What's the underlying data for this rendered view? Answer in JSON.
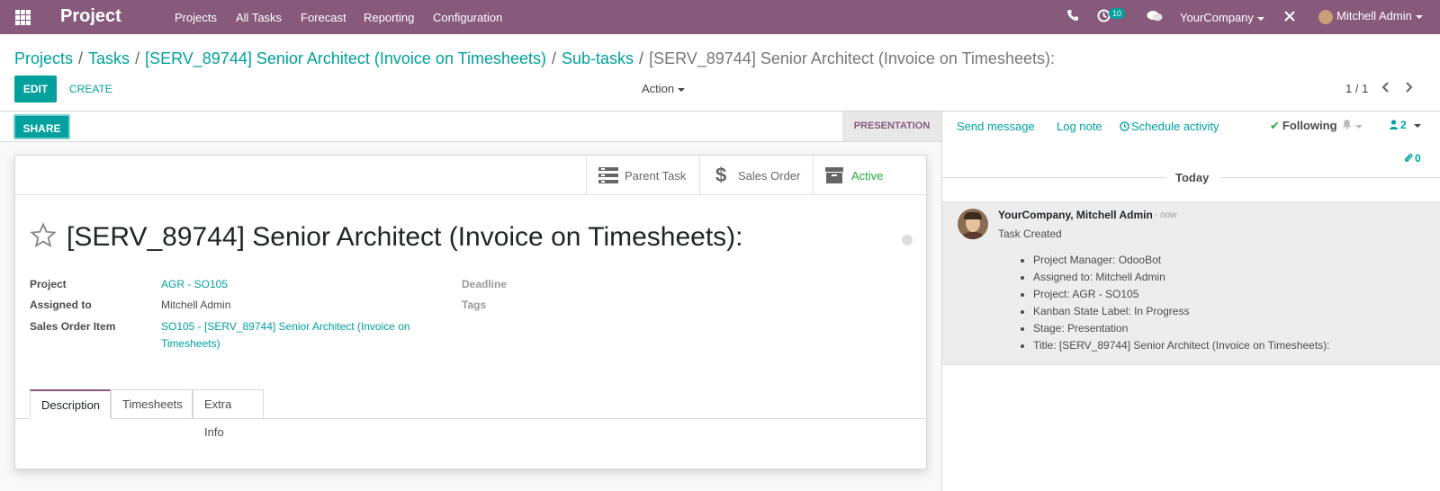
{
  "navbar": {
    "app_name": "Project",
    "menu": [
      "Projects",
      "All Tasks",
      "Forecast",
      "Reporting",
      "Configuration"
    ],
    "activity_count": "10",
    "company": "YourCompany",
    "user": "Mitchell Admin",
    "icons": [
      "apps-icon",
      "phone-icon",
      "activity-icon",
      "chat-icon",
      "debug-icon"
    ]
  },
  "breadcrumb": {
    "items": [
      "Projects",
      "Tasks",
      "[SERV_89744] Senior Architect (Invoice on Timesheets)",
      "Sub-tasks"
    ],
    "current": "[SERV_89744] Senior Architect (Invoice on Timesheets):"
  },
  "toolbar": {
    "edit_label": "EDIT",
    "create_label": "CREATE",
    "action_label": "Action",
    "pager": "1 / 1"
  },
  "statusbar": {
    "share_label": "SHARE",
    "stage": "PRESENTATION"
  },
  "smart_buttons": {
    "parent_task": "Parent Task",
    "sales_order": "Sales Order",
    "active": "Active"
  },
  "task": {
    "title": "[SERV_89744] Senior Architect (Invoice on Timesheets):",
    "fields": {
      "project_label": "Project",
      "project_value": "AGR - SO105",
      "assigned_label": "Assigned to",
      "assigned_value": "Mitchell Admin",
      "so_item_label": "Sales Order Item",
      "so_item_value_line1": "SO105 - [SERV_89744] Senior Architect (Invoice on",
      "so_item_value_line2": "Timesheets)",
      "deadline_label": "Deadline",
      "tags_label": "Tags"
    },
    "tabs": [
      "Description",
      "Timesheets",
      "Extra Info"
    ]
  },
  "chatter": {
    "send_message": "Send message",
    "log_note": "Log note",
    "schedule_activity": "Schedule activity",
    "following": "Following",
    "followers_count": "2",
    "attachments_count": "0",
    "today": "Today",
    "message": {
      "author": "YourCompany, Mitchell Admin",
      "when": "- now",
      "body": "Task Created",
      "changes": [
        "Project Manager: OdooBot",
        "Assigned to: Mitchell Admin",
        "Project: AGR - SO105",
        "Kanban State Label: In Progress",
        "Stage: Presentation",
        "Title: [SERV_89744] Senior Architect (Invoice on Timesheets):"
      ]
    }
  },
  "colors": {
    "brand": "#875a7b",
    "accent": "#00a09d",
    "active_green": "#28a745"
  }
}
